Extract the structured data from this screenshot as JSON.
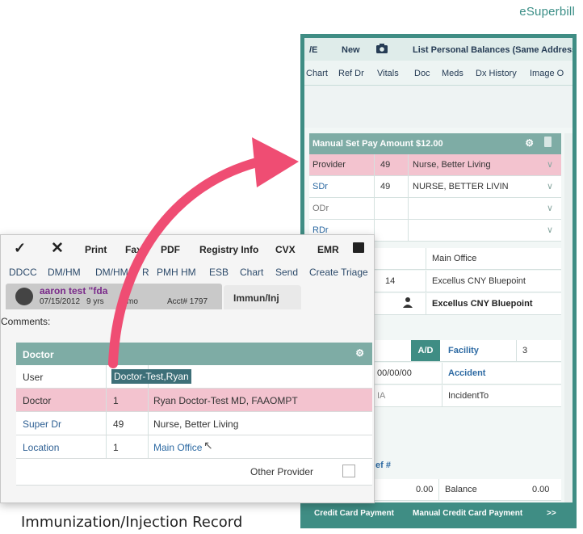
{
  "brand": "eSuperbill",
  "caption": "Immunization/Injection Record",
  "colors": {
    "teal": "#3f8d84",
    "panel_header": "#7eaca5",
    "pink_highlight": "#f3c3cf",
    "arrow": "#ef4d73"
  },
  "right_window": {
    "toolbar": {
      "item0": "/E",
      "new": "New",
      "camera_icon": "camera-icon",
      "list_balances": "List Personal Balances (Same Address)"
    },
    "nav": [
      "Chart",
      "Ref Dr",
      "Vitals",
      "Doc",
      "Meds",
      "Dx History",
      "Image O"
    ],
    "panel_title": "Manual Set Pay Amount $12.00",
    "rows": [
      {
        "label": "Provider",
        "code": "49",
        "name": "Nurse, Better Living"
      },
      {
        "label": "SDr",
        "code": "49",
        "name": "NURSE, BETTER LIVIN"
      },
      {
        "label": "ODr",
        "code": "",
        "name": ""
      },
      {
        "label": "RDr",
        "code": "",
        "name": ""
      }
    ],
    "location": "Main Office",
    "insurance1_code": "14",
    "insurance1": "Excellus CNY Bluepoint",
    "insurance2": "Excellus CNY Bluepoint",
    "ad_label": "A/D",
    "facility_label": "Facility",
    "facility_value": "3",
    "date_fragment": "00/00/00",
    "accident_label": "Accident",
    "na_fragment": "IA",
    "incident_label": "IncidentTo",
    "ref_label": "ef #",
    "amount": "0.00",
    "balance_label": "Balance",
    "balance_value": "0.00",
    "bottom_buttons": {
      "credit": "Credit Card Payment",
      "manual_credit": "Manual Credit Card Payment",
      "more": ">>"
    }
  },
  "left_window": {
    "toolbar": {
      "print": "Print",
      "fax": "Fax",
      "pdf": "PDF",
      "registry": "Registry Info",
      "cvx": "CVX",
      "emr": "EMR"
    },
    "nav": [
      "DDCC",
      "DM/HM",
      "DM/HM",
      "R",
      "PMH HM",
      "ESB",
      "Chart",
      "Send",
      "Create Triage",
      "C"
    ],
    "patient": {
      "name": "aaron test \"fda",
      "dob": "07/15/2012",
      "age": "9 yrs",
      "age_suffix": "mo",
      "acct": "Acct# 1797"
    },
    "tab_label": "Immun/Inj",
    "comments_label": "Comments:",
    "panel_title": "Doctor",
    "rows": [
      {
        "label": "User",
        "code": "",
        "value": "Doctor-Test,Ryan"
      },
      {
        "label": "Doctor",
        "code": "1",
        "value": "Ryan Doctor-Test MD, FAAOMPT"
      },
      {
        "label": "Super Dr",
        "code": "49",
        "value": "Nurse, Better Living"
      },
      {
        "label": "Location",
        "code": "1",
        "value": "Main Office"
      }
    ],
    "other_provider": "Other Provider"
  }
}
